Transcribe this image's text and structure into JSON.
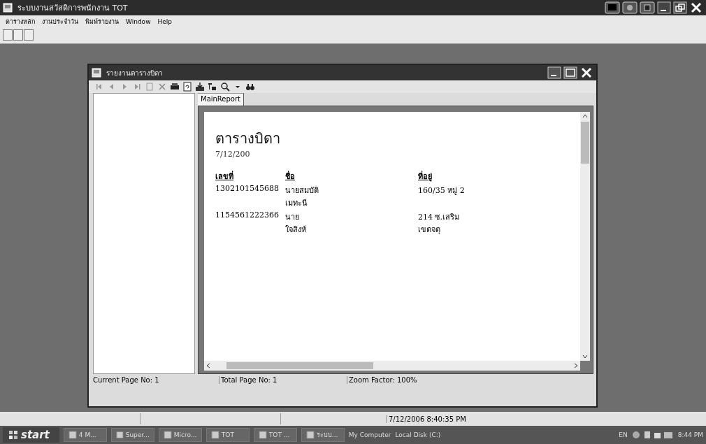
{
  "window": {
    "title": "ระบบงานสวัสดิการพนักงาน TOT"
  },
  "menu": [
    "ตารางหลัก",
    "งานประจำวัน",
    "พิมพ์รายงาน",
    "Window",
    "Help"
  ],
  "report_window": {
    "title": "รายงานตารางบิดา",
    "tabs": [
      {
        "label": "MainReport",
        "selected": true
      }
    ],
    "report": {
      "title": "ตารางบิดา",
      "date": "7/12/200",
      "columns": [
        "เลขที่",
        "ชื่อ",
        "ที่อยู่"
      ],
      "rows": [
        {
          "cells": [
            [
              "1302101545688"
            ],
            [
              "นายสมบัติ",
              "เมทะนี"
            ],
            [
              "160/35 หมู่ 2"
            ]
          ]
        },
        {
          "cells": [
            [
              "1154561222366"
            ],
            [
              "นาย",
              "ใจสิงห์"
            ],
            [
              "214 ซ.เสริม",
              "เขตจตุ"
            ]
          ]
        }
      ]
    },
    "status": [
      "Current Page No: 1",
      "Total Page No: 1",
      "Zoom Factor: 100%"
    ]
  },
  "status_bar": {
    "datetime": "7/12/2006 8:40:35 PM"
  },
  "taskbar": {
    "start": "start",
    "items": [
      "4 M...",
      "Super...",
      "Micro...",
      "TOT",
      "TOT ...",
      "ระบบ..."
    ],
    "address": [
      "My Computer",
      "Local Disk (C:)"
    ],
    "language": "EN",
    "clock": "8:44 PM"
  }
}
